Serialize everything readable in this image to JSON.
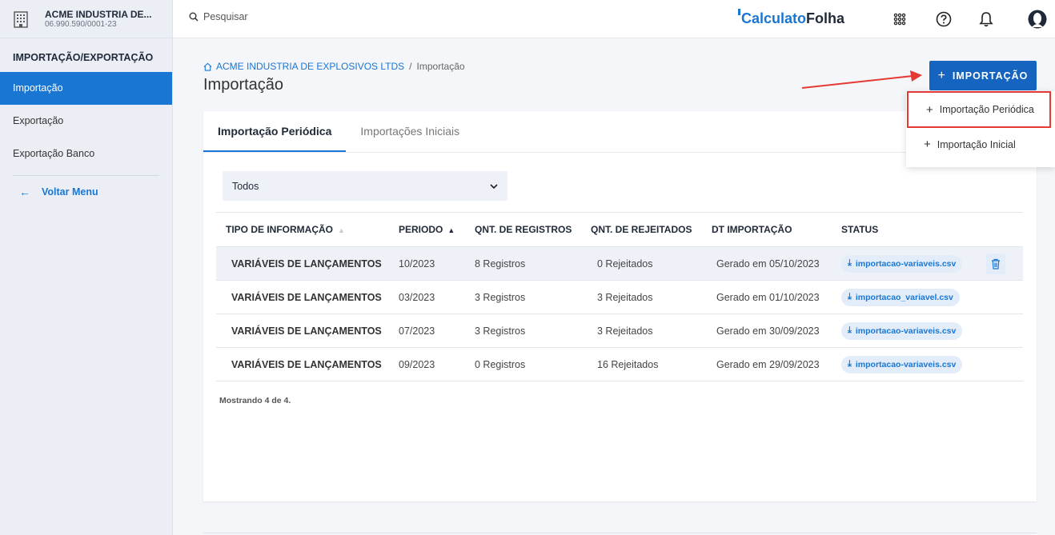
{
  "sidebar": {
    "company_name": "ACME INDUSTRIA DE...",
    "company_cnpj": "06.990.590/0001-23",
    "section_title": "IMPORTAÇÃO/EXPORTAÇÃO",
    "items": [
      {
        "label": "Importação",
        "active": true
      },
      {
        "label": "Exportação",
        "active": false
      },
      {
        "label": "Exportação Banco",
        "active": false
      }
    ],
    "back_label": "Voltar Menu"
  },
  "header": {
    "search_placeholder": "Pesquisar",
    "brand_part1": "Calculato",
    "brand_part2": "Folha",
    "icons": [
      "apps-grid-icon",
      "help-icon",
      "bell-icon",
      "user-avatar-icon"
    ]
  },
  "breadcrumb": {
    "root": "ACME INDUSTRIA DE EXPLOSIVOS LTDS",
    "separator": "/",
    "current": "Importação"
  },
  "page_title": "Importação",
  "import_button_label": "IMPORTAÇÃO",
  "dropdown": {
    "items": [
      "Importação Periódica",
      "Importação Inicial"
    ]
  },
  "tabs": [
    {
      "label": "Importação Periódica",
      "active": true
    },
    {
      "label": "Importações Iniciais",
      "active": false
    }
  ],
  "filter": {
    "value": "Todos"
  },
  "table": {
    "headers": [
      "TIPO DE INFORMAÇÃO",
      "PERIODO",
      "QNT. DE REGISTROS",
      "QNT. DE REJEITADOS",
      "DT IMPORTAÇÃO",
      "STATUS"
    ],
    "rows": [
      {
        "tipo": "VARIÁVEIS DE LANÇAMENTOS",
        "periodo": "10/2023",
        "registros": "8 Registros",
        "rejeitados": "0 Rejeitados",
        "dt": "Gerado em 05/10/2023",
        "status": "importacao-variaveis.csv",
        "highlight": true
      },
      {
        "tipo": "VARIÁVEIS DE LANÇAMENTOS",
        "periodo": "03/2023",
        "registros": "3 Registros",
        "rejeitados": "3 Rejeitados",
        "dt": "Gerado em 01/10/2023",
        "status": "importacao_variavel.csv",
        "highlight": false
      },
      {
        "tipo": "VARIÁVEIS DE LANÇAMENTOS",
        "periodo": "07/2023",
        "registros": "3 Registros",
        "rejeitados": "3 Rejeitados",
        "dt": "Gerado em 30/09/2023",
        "status": "importacao-variaveis.csv",
        "highlight": false
      },
      {
        "tipo": "VARIÁVEIS DE LANÇAMENTOS",
        "periodo": "09/2023",
        "registros": "0 Registros",
        "rejeitados": "16 Rejeitados",
        "dt": "Gerado em 29/09/2023",
        "status": "importacao-variaveis.csv",
        "highlight": false
      }
    ]
  },
  "showing_text": "Mostrando 4 de 4.",
  "colors": {
    "primary": "#1976d2",
    "button": "#1565c0",
    "highlight_border": "#e53935"
  }
}
